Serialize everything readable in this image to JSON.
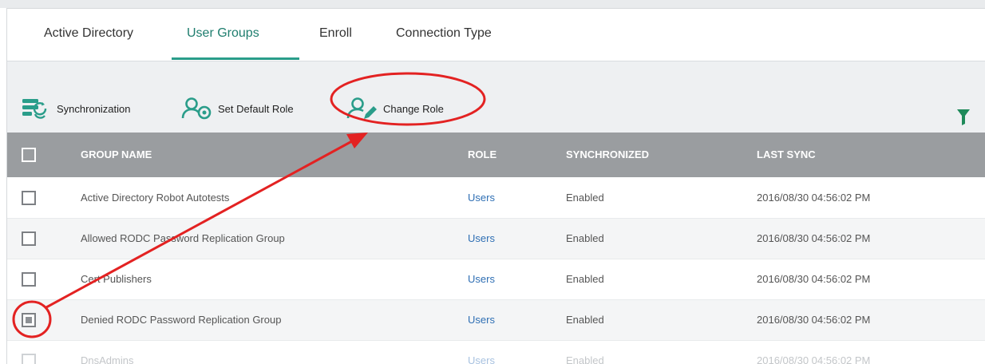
{
  "tabs": [
    {
      "label": "Active Directory",
      "active": false
    },
    {
      "label": "User Groups",
      "active": true
    },
    {
      "label": "Enroll",
      "active": false
    },
    {
      "label": "Connection Type",
      "active": false
    }
  ],
  "toolbar": {
    "synchronization_label": "Synchronization",
    "set_default_role_label": "Set Default Role",
    "change_role_label": "Change Role",
    "filter_icon": "funnel-icon"
  },
  "table": {
    "columns": [
      "GROUP NAME",
      "ROLE",
      "SYNCHRONIZED",
      "LAST SYNC"
    ],
    "rows": [
      {
        "name": "Active Directory Robot Autotests",
        "role": "Users",
        "synchronized": "Enabled",
        "last_sync": "2016/08/30 04:56:02 PM",
        "checked": false
      },
      {
        "name": "Allowed RODC Password Replication Group",
        "role": "Users",
        "synchronized": "Enabled",
        "last_sync": "2016/08/30 04:56:02 PM",
        "checked": false
      },
      {
        "name": "Cert Publishers",
        "role": "Users",
        "synchronized": "Enabled",
        "last_sync": "2016/08/30 04:56:02 PM",
        "checked": false
      },
      {
        "name": "Denied RODC Password Replication Group",
        "role": "Users",
        "synchronized": "Enabled",
        "last_sync": "2016/08/30 04:56:02 PM",
        "checked": true
      },
      {
        "name": "DnsAdmins",
        "role": "Users",
        "synchronized": "Enabled",
        "last_sync": "2016/08/30 04:56:02 PM",
        "checked": false
      }
    ]
  },
  "colors": {
    "accent": "#2a9d8a",
    "role_link": "#2f6fb4",
    "header_bg": "#9a9da0",
    "annotation_red": "#e32222"
  }
}
